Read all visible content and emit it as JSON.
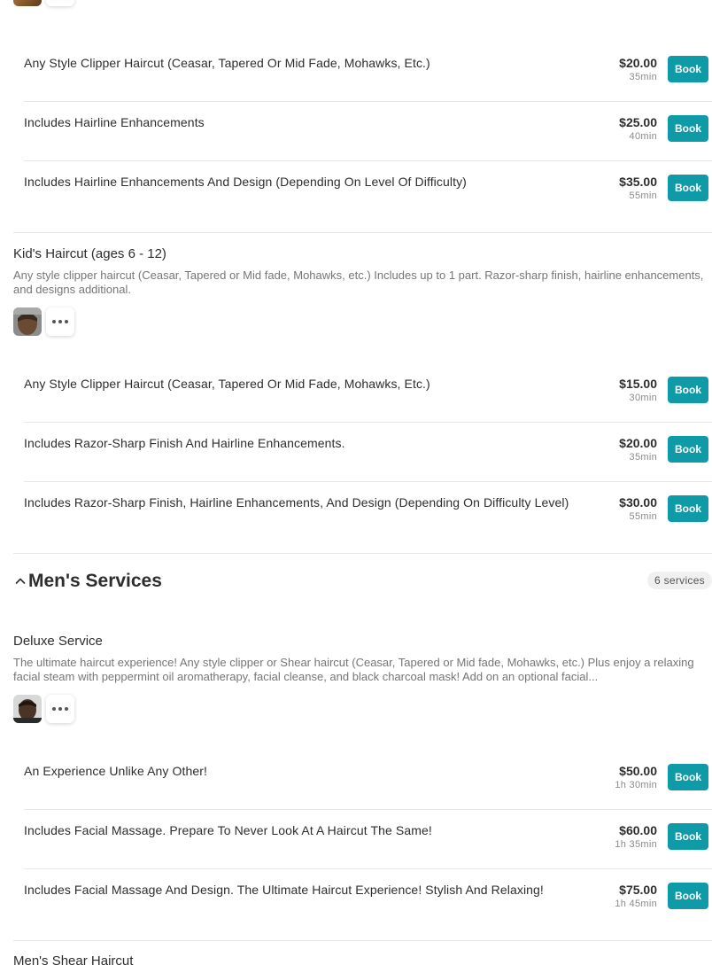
{
  "groups": [
    {
      "options": [
        {
          "name": "Any Style Clipper Haircut (Ceasar, Tapered Or Mid Fade, Mohawks, Etc.)",
          "price": "$20.00",
          "duration": "35min"
        },
        {
          "name": "Includes Hairline Enhancements",
          "price": "$25.00",
          "duration": "40min"
        },
        {
          "name": "Includes Hairline Enhancements And Design (Depending On Level Of Difficulty)",
          "price": "$35.00",
          "duration": "55min"
        }
      ]
    },
    {
      "title": "Kid's Haircut (ages 6 - 12)",
      "description": "Any style clipper haircut (Ceasar, Tapered or Mid fade, Mohawks, etc.) Includes up to 1 part. Razor-sharp finish, hairline enhancements, and designs additional.",
      "options": [
        {
          "name": "Any Style Clipper Haircut (Ceasar, Tapered Or Mid Fade, Mohawks, Etc.)",
          "price": "$15.00",
          "duration": "30min"
        },
        {
          "name": "Includes Razor-Sharp Finish And Hairline Enhancements.",
          "price": "$20.00",
          "duration": "35min"
        },
        {
          "name": "Includes Razor-Sharp Finish, Hairline Enhancements, And Design (Depending On Difficulty Level)",
          "price": "$30.00",
          "duration": "55min"
        }
      ]
    },
    {
      "title": "Deluxe Service",
      "description": "The ultimate haircut experience! Any style clipper or Shear haircut (Ceasar, Tapered or Mid fade, Mohawks, etc.) Plus enjoy a relaxing facial steam with peppermint oil aromatherapy, facial cleanse, and black charcoal mask! Add on an optional facial...",
      "options": [
        {
          "name": "An Experience Unlike Any Other!",
          "price": "$50.00",
          "duration": "1h 30min"
        },
        {
          "name": "Includes Facial Massage. Prepare To Never Look At A Haircut The Same!",
          "price": "$60.00",
          "duration": "1h 35min"
        },
        {
          "name": "Includes Facial Massage And Design. The Ultimate Haircut Experience! Stylish And Relaxing!",
          "price": "$75.00",
          "duration": "1h 45min"
        }
      ]
    },
    {
      "title": "Men's Shear Haircut"
    }
  ],
  "category": {
    "title": "Men's Services",
    "count": "6 services",
    "chevron_icon": "chevron-up-icon"
  },
  "book_label": "Book",
  "more_icon": "more-dots-icon",
  "colors": {
    "accent": "#0f9aa8"
  }
}
